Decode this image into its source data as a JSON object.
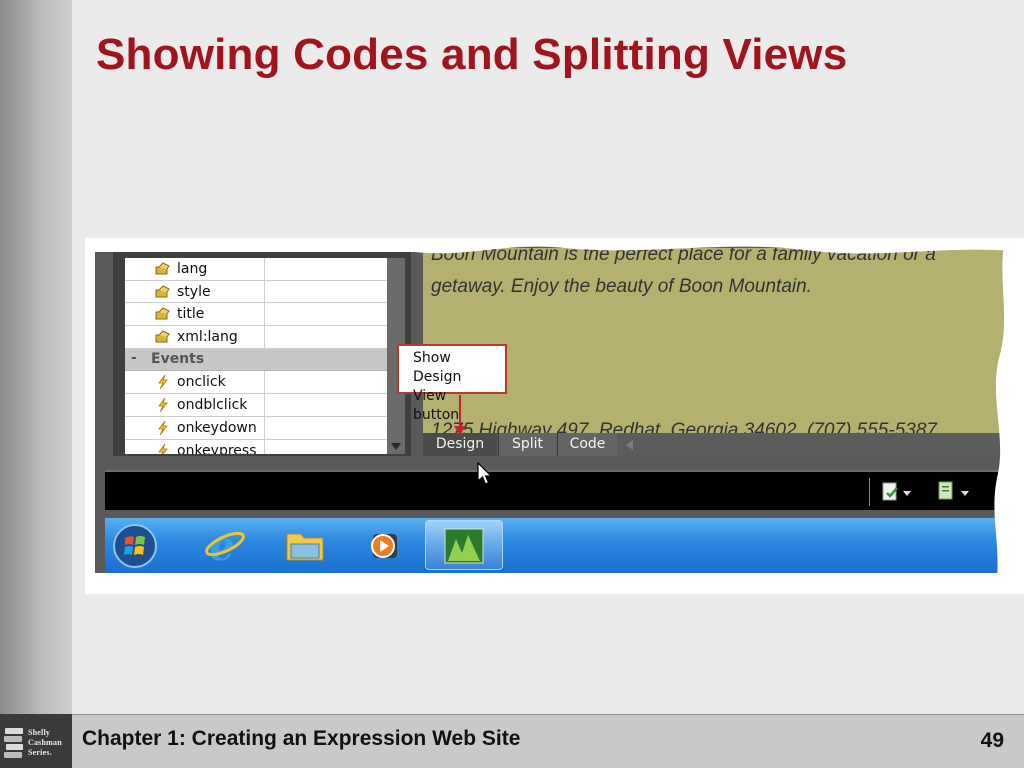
{
  "slide": {
    "title": "Showing Codes and Splitting Views",
    "footer_chapter": "Chapter 1: Creating an Expression Web Site",
    "page_number": "49",
    "logo_lines": [
      "Shelly",
      "Cashman",
      "Series."
    ]
  },
  "properties_panel": {
    "rows": [
      {
        "name": "lang",
        "icon": "attribute-icon"
      },
      {
        "name": "style",
        "icon": "attribute-icon"
      },
      {
        "name": "title",
        "icon": "attribute-icon"
      },
      {
        "name": "xml:lang",
        "icon": "attribute-icon"
      }
    ],
    "events_header": "Events",
    "events_collapse": "-",
    "events": [
      {
        "name": "onclick",
        "icon": "event-lightning-icon"
      },
      {
        "name": "ondblclick",
        "icon": "event-lightning-icon"
      },
      {
        "name": "onkeydown",
        "icon": "event-lightning-icon"
      },
      {
        "name": "onkeypress",
        "icon": "event-lightning-icon"
      }
    ]
  },
  "design_view": {
    "line1": "Boon Mountain is the perfect place for a family vacation or a",
    "line2": "getaway. Enjoy the beauty of Boon Mountain.",
    "line3": "1275 Highway 497, Redhat, Georgia 34602, (707) 555-5387",
    "background": "#b4b070"
  },
  "callout": {
    "line1": "Show Design",
    "line2": "View button",
    "color": "#c8202a"
  },
  "view_tabs": [
    "Design",
    "Split",
    "Code"
  ],
  "status_bar": {
    "buttons": [
      "publish-status-icon",
      "code-status-icon"
    ]
  },
  "taskbar": {
    "items": [
      "start-button",
      "internet-explorer-icon",
      "windows-explorer-icon",
      "media-player-icon",
      "expression-web-icon"
    ],
    "active": "expression-web-icon"
  },
  "colors": {
    "title": "#a0141e",
    "callout_border": "#b83a2e",
    "taskbar": "#2c8ae0"
  }
}
